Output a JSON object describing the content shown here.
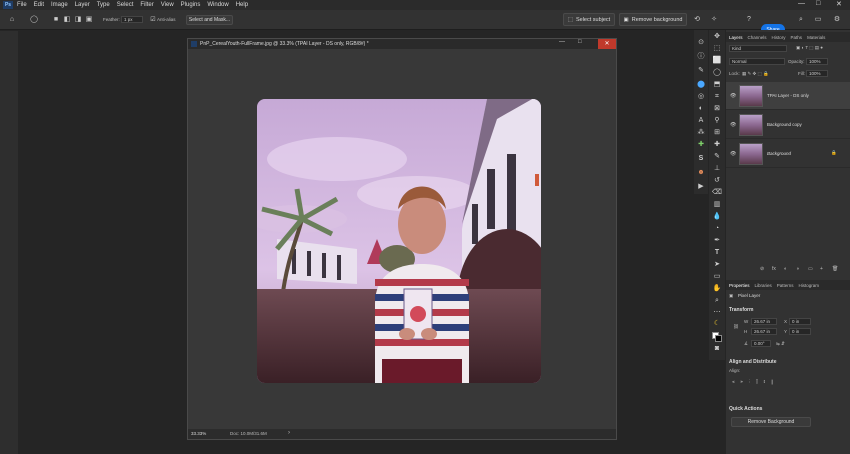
{
  "app": {
    "logo": "Ps",
    "menu": [
      "File",
      "Edit",
      "Image",
      "Layer",
      "Type",
      "Select",
      "Filter",
      "View",
      "Plugins",
      "Window",
      "Help"
    ],
    "window_controls": [
      "—",
      "□",
      "✕"
    ]
  },
  "options_bar": {
    "feather_label": "Feather:",
    "feather_value": "1 px",
    "anti_alias_label": "Anti-alias",
    "select_and_mask": "Select and Mask...",
    "select_subject": "Select subject",
    "remove_background": "Remove background",
    "share": "Share"
  },
  "document": {
    "title": "PnP_CerealYouth-FullFrame.jpg @ 33.3% (TPAI Layer - DS only, RGB/8#) *",
    "controls": [
      "—",
      "□"
    ],
    "close": "✕",
    "zoom": "33.33%",
    "doc_info": "Doc: 10.0M/31.6M",
    "chevron": "›"
  },
  "layers_panel": {
    "tabs": [
      "Layers",
      "Channels",
      "History",
      "Paths",
      "Materials"
    ],
    "active_tab": "Layers",
    "kind_label": "Kind",
    "blend_mode": "Normal",
    "opacity_label": "Opacity:",
    "opacity_value": "100%",
    "lock_label": "Lock:",
    "fill_label": "Fill:",
    "fill_value": "100%",
    "layers": [
      {
        "name": "TPAI Layer - DS only",
        "selected": true,
        "locked": false
      },
      {
        "name": "Background copy",
        "selected": false,
        "locked": false
      },
      {
        "name": "Background",
        "selected": false,
        "locked": true
      }
    ],
    "footer_icons": [
      "⊘",
      "fx",
      "◐",
      "◑",
      "▭",
      "+",
      "🗑"
    ]
  },
  "properties_panel": {
    "tabs": [
      "Properties",
      "Libraries",
      "Patterns",
      "Histogram"
    ],
    "active_tab": "Properties",
    "pixel_layer_label": "Pixel Layer",
    "transform_label": "Transform",
    "w_label": "W",
    "w_value": "26.67 in",
    "h_label": "H",
    "h_value": "26.67 in",
    "x_label": "X",
    "x_value": "0 in",
    "y_label": "Y",
    "y_value": "0 in",
    "angle_value": "0.00°",
    "align_label": "Align and Distribute",
    "align_sub": "Align:",
    "quick_actions_label": "Quick Actions",
    "remove_background_button": "Remove Background"
  },
  "colors": {
    "accent": "#1473e6",
    "panel_bg": "#323232",
    "app_bg": "#252525",
    "close_red": "#c0392b"
  }
}
